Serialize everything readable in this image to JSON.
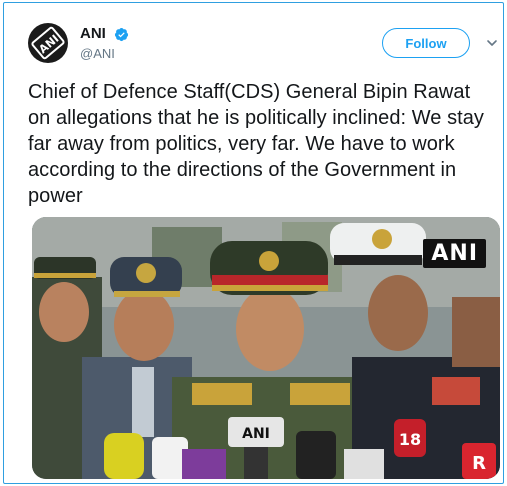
{
  "tweet": {
    "author": {
      "name": "ANI",
      "handle": "@ANI",
      "avatar_text": "ANI",
      "verified": true
    },
    "follow_label": "Follow",
    "text": "Chief of Defence Staff(CDS) General Bipin Rawat on allegations that he is politically inclined: We stay far away from politics, very far. We have to work according to the directions of the Government in power",
    "media": {
      "watermark": "ANI",
      "mic_labels": [
        "ANI",
        "18",
        "R"
      ]
    }
  },
  "colors": {
    "accent": "#1da1f2",
    "frame_border": "#2f9fe0",
    "text": "#14171a",
    "secondary_text": "#657786"
  },
  "icons": [
    "verified-badge-icon",
    "chevron-down-icon"
  ]
}
